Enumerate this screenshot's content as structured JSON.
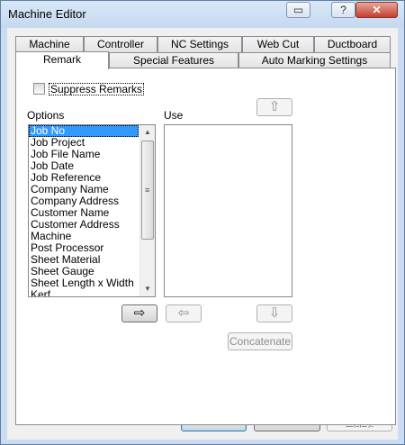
{
  "window": {
    "title": "Machine Editor"
  },
  "titlebar": {
    "restore": "▭",
    "help": "?",
    "close": "✕"
  },
  "tabs_row1": [
    "Machine",
    "Controller",
    "NC Settings",
    "Web Cut",
    "Ductboard"
  ],
  "tabs_row2": [
    "Remark",
    "Special Features",
    "Auto Marking Settings"
  ],
  "remark": {
    "suppress_label": "Suppress Remarks",
    "suppress_checked": false,
    "options_label": "Options",
    "use_label": "Use",
    "options": [
      "Job No",
      "Job Project",
      "Job File Name",
      "Job Date",
      "Job Reference",
      "Company Name",
      "Company Address",
      "Customer Name",
      "Customer Address",
      "Machine",
      "Post Processor",
      "Sheet Material",
      "Sheet Gauge",
      "Sheet Length x Width",
      "Kerf"
    ],
    "selected_option": "Job No",
    "use_items": [],
    "move_right_icon": "⇨",
    "move_left_icon": "⇦",
    "move_up_icon": "⇧",
    "move_down_icon": "⇩",
    "concatenate_label": "Concatenate"
  },
  "footer": {
    "ok": "OK",
    "cancel": "Cancel",
    "apply": "Apply"
  }
}
